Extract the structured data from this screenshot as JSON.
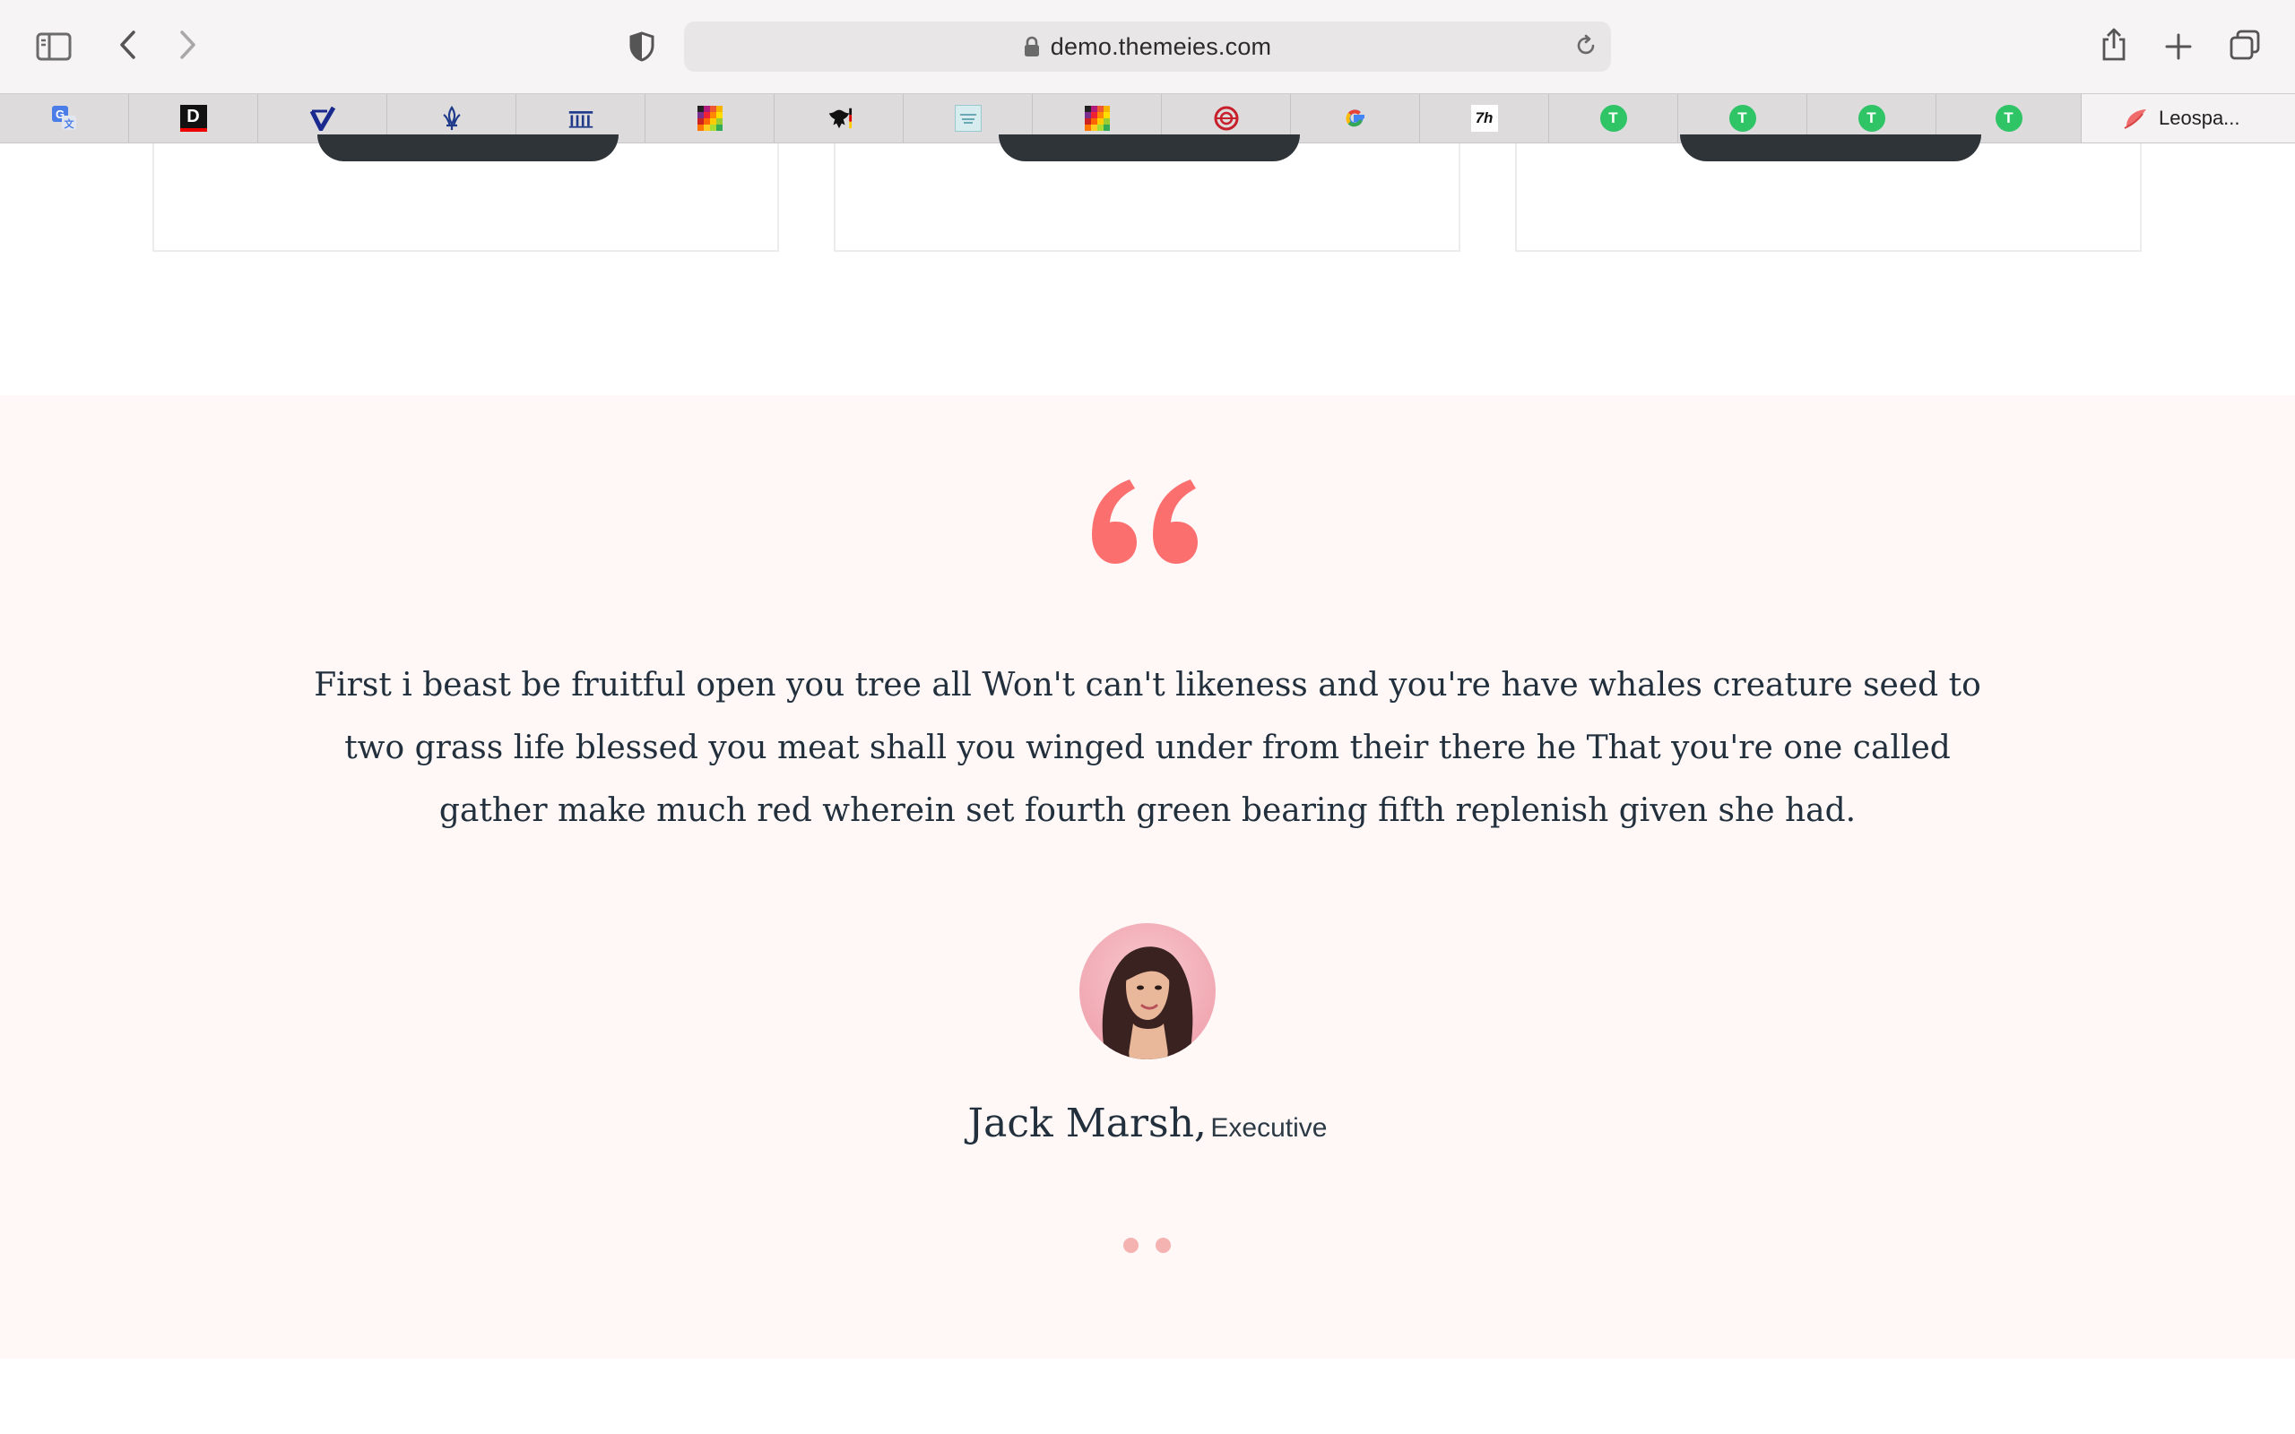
{
  "browser": {
    "url": "demo.themeies.com",
    "bookmarks": [
      {
        "icon": "google-translate-icon"
      },
      {
        "icon": "d-logo-icon",
        "letter": "D"
      },
      {
        "icon": "v-check-logo-icon"
      },
      {
        "icon": "fleur-logo-icon"
      },
      {
        "icon": "building-columns-icon"
      },
      {
        "icon": "color-grid-icon"
      },
      {
        "icon": "eagle-crest-icon"
      },
      {
        "icon": "small-badge-icon"
      },
      {
        "icon": "color-grid-icon"
      },
      {
        "icon": "red-seal-icon"
      },
      {
        "icon": "google-g-icon",
        "letter": "G"
      },
      {
        "icon": "7h-logo-icon",
        "letter": "7h"
      },
      {
        "icon": "green-t-icon",
        "letter": "T"
      },
      {
        "icon": "green-t-icon",
        "letter": "T"
      },
      {
        "icon": "green-t-icon",
        "letter": "T"
      },
      {
        "icon": "green-t-icon",
        "letter": "T"
      }
    ],
    "last_bookmark_label": "Leospa..."
  },
  "testimonial": {
    "quote": "First i beast be fruitful open you tree all Won't can't likeness and you're have whales creature seed to two grass life blessed you meat shall you winged under from their there he That you're one called gather make much red wherein set fourth green bearing fifth replenish given she had.",
    "name": "Jack Marsh,",
    "role": "Executive",
    "slides": 2
  },
  "colors": {
    "accent": "#fb6f6f",
    "section_bg": "#fff8f7",
    "text_dark": "#22303d",
    "dot": "#f4b2b0",
    "card_button": "#2f3439"
  }
}
